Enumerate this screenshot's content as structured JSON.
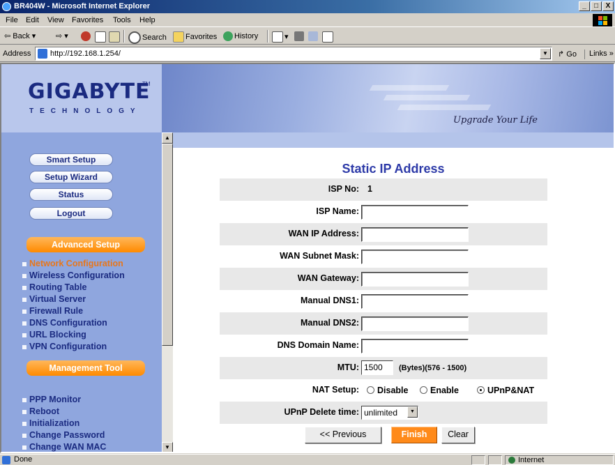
{
  "window": {
    "title": "BR404W - Microsoft Internet Explorer",
    "min": "_",
    "max": "□",
    "close": "X"
  },
  "menu": [
    "File",
    "Edit",
    "View",
    "Favorites",
    "Tools",
    "Help"
  ],
  "toolbar": {
    "back": "Back",
    "search": "Search",
    "favorites": "Favorites",
    "history": "History"
  },
  "address": {
    "label": "Address",
    "url": "http://192.168.1.254/",
    "go": "Go",
    "links": "Links"
  },
  "banner": {
    "logo": "GIGABYTE",
    "logo_tm": "TM",
    "logo_sub": "TECHNOLOGY",
    "tagline": "Upgrade Your Life"
  },
  "sidebar": {
    "buttons": [
      "Smart Setup",
      "Setup Wizard",
      "Status",
      "Logout"
    ],
    "advanced_title": "Advanced Setup",
    "advanced_items": [
      "Network Configuration",
      "Wireless Configuration",
      "Routing Table",
      "Virtual Server",
      "Firewall Rule",
      "DNS Configuration",
      "URL Blocking",
      "VPN Configuration"
    ],
    "management_title": "Management Tool",
    "management_items": [
      "PPP Monitor",
      "Reboot",
      "Initialization",
      "Change Password",
      "Change WAN MAC"
    ]
  },
  "main": {
    "title": "Static IP Address",
    "isp_no_label": "ISP No:",
    "isp_no_value": "1",
    "labels": {
      "isp_name": "ISP Name:",
      "wan_ip": "WAN IP Address:",
      "wan_subnet": "WAN Subnet Mask:",
      "wan_gateway": "WAN Gateway:",
      "dns1": "Manual DNS1:",
      "dns2": "Manual DNS2:",
      "dns_domain": "DNS Domain Name:",
      "mtu": "MTU:",
      "nat": "NAT Setup:",
      "upnp_delete": "UPnP Delete time:"
    },
    "mtu_value": "1500",
    "mtu_note": "(Bytes)(576 - 1500)",
    "nat_options": [
      "Disable",
      "Enable",
      "UPnP&NAT"
    ],
    "nat_selected": "UPnP&NAT",
    "upnp_delete_value": "unlimited",
    "buttons": {
      "previous": "<< Previous",
      "finish": "Finish",
      "clear": "Clear"
    }
  },
  "status": {
    "text": "Done",
    "zone": "Internet"
  },
  "colors": {
    "title_dark": "#0a246a",
    "sidebar": "#8fa6de",
    "orange": "#ff8a1a",
    "heading": "#2d3aa8"
  }
}
